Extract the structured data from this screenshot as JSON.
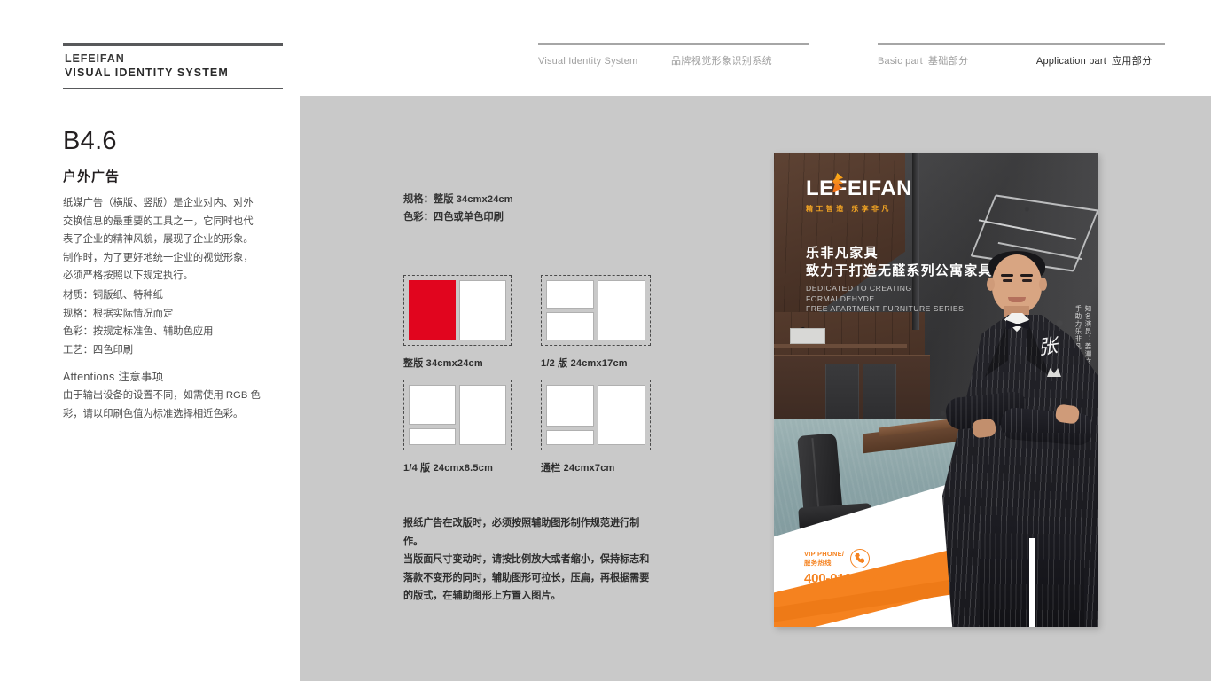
{
  "brand": {
    "line1": "LEFEIFAN",
    "line2": "VISUAL IDENTITY SYSTEM"
  },
  "header": {
    "group1": {
      "en": "Visual Identity System",
      "cn": "品牌视觉形象识别系统"
    },
    "group2": {
      "basic_en": "Basic part",
      "basic_cn": "基础部分",
      "app_en": "Application part",
      "app_cn": "应用部分"
    }
  },
  "section": {
    "code": "B4.6",
    "title": "户外广告",
    "body": [
      "纸媒广告（横版、竖版）是企业对内、对外",
      "交换信息的最重要的工具之一，它同时也代",
      "表了企业的精神风貌，展现了企业的形象。",
      "制作时，为了更好地统一企业的视觉形象，",
      "必须严格按照以下规定执行。"
    ],
    "specs": [
      "材质：铜版纸、特种纸",
      "规格：根据实际情况而定",
      "色彩：按规定标准色、辅助色应用",
      "工艺：四色印刷"
    ],
    "attentions_title": "Attentions 注意事项",
    "attentions_body": [
      "由于输出设备的设置不同，如需使用 RGB 色",
      "彩，请以印刷色值为标准选择相近色彩。"
    ]
  },
  "center": {
    "spec_lines": [
      "规格：整版 34cmx24cm",
      "色彩：四色或单色印刷"
    ],
    "thumbs": [
      {
        "label": "整版 34cmx24cm"
      },
      {
        "label": "1/2 版 24cmx17cm"
      },
      {
        "label": "1/4 版 24cmx8.5cm"
      },
      {
        "label": "通栏 24cmx7cm"
      }
    ],
    "note": [
      "报纸广告在改版时，必须按照辅助图形制作规范进行制作。",
      "当版面尺寸变动时，请按比例放大或者缩小，保持标志和",
      "落款不变形的同时，辅助图形可拉长，压扁，再根据需要",
      "的版式，在辅助图形上方置入图片。"
    ]
  },
  "poster": {
    "logo_text": "LEFEIFAN",
    "logo_tagline": "精工智造 乐享非凡",
    "headline_1": "乐非凡家具",
    "headline_2": "致力于打造无醛系列公寓家具",
    "subtitle_en": [
      "DEDICATED TO CREATING",
      "FORMALDEHYDE",
      "FREE APARTMENT FURNITURE SERIES"
    ],
    "vertical_text": "知名演员：姜潮文 携手助力乐非凡家居",
    "signature": "张",
    "vip_label_en": "VIP PHONE/",
    "vip_label_cn": "服务热线",
    "vip_number": "400-0123-277"
  },
  "colors": {
    "accent_orange": "#f5821f",
    "accent_yellow": "#fcbd18",
    "swatch_red": "#e1051e",
    "panel_gray": "#c9c9c9"
  }
}
